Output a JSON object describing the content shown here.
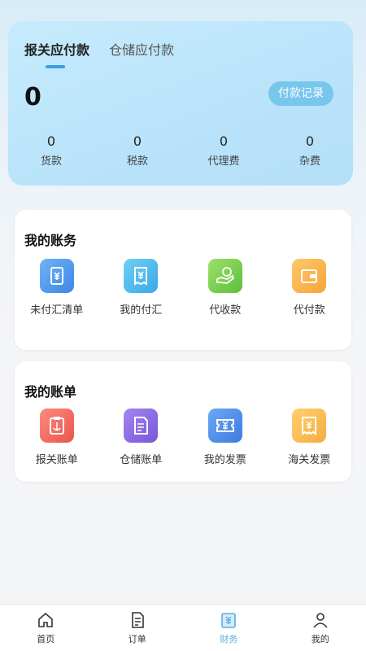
{
  "summary": {
    "tabs": [
      "报关应付款",
      "仓储应付款"
    ],
    "active_tab": 0,
    "total": "0",
    "pay_record": "付款记录",
    "stats": [
      {
        "value": "0",
        "label": "货款"
      },
      {
        "value": "0",
        "label": "税款"
      },
      {
        "value": "0",
        "label": "代理费"
      },
      {
        "value": "0",
        "label": "杂费"
      }
    ]
  },
  "accounts": {
    "title": "我的账务",
    "items": [
      {
        "label": "未付汇清单",
        "icon": "scroll-yuan-icon"
      },
      {
        "label": "我的付汇",
        "icon": "receipt-yuan-icon"
      },
      {
        "label": "代收款",
        "icon": "hand-coin-icon"
      },
      {
        "label": "代付款",
        "icon": "wallet-icon"
      }
    ]
  },
  "bills": {
    "title": "我的账单",
    "items": [
      {
        "label": "报关账单",
        "icon": "clipboard-anchor-icon"
      },
      {
        "label": "仓储账单",
        "icon": "document-icon"
      },
      {
        "label": "我的发票",
        "icon": "ticket-yuan-icon"
      },
      {
        "label": "海关发票",
        "icon": "invoice-yuan-icon"
      }
    ]
  },
  "tabbar": {
    "items": [
      {
        "label": "首页",
        "icon": "home-icon"
      },
      {
        "label": "订单",
        "icon": "order-icon"
      },
      {
        "label": "财务",
        "icon": "finance-icon"
      },
      {
        "label": "我的",
        "icon": "user-icon"
      }
    ],
    "active": 2,
    "active_color": "#5aaee0"
  }
}
